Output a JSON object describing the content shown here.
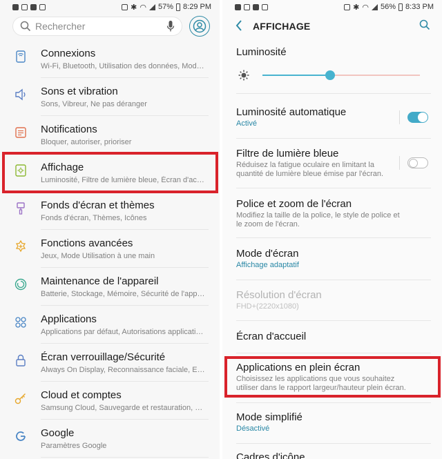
{
  "left": {
    "status": {
      "battery": "57%",
      "time": "8:29 PM"
    },
    "search": {
      "placeholder": "Rechercher"
    },
    "items": [
      {
        "title": "Connexions",
        "subtitle": "Wi-Fi, Bluetooth, Utilisation des données, Mode Hors-ligne",
        "icon": "connections-icon"
      },
      {
        "title": "Sons et vibration",
        "subtitle": "Sons, Vibreur, Ne pas déranger",
        "icon": "speaker-icon"
      },
      {
        "title": "Notifications",
        "subtitle": "Bloquer, autoriser, prioriser",
        "icon": "notifications-icon"
      },
      {
        "title": "Affichage",
        "subtitle": "Luminosité, Filtre de lumière bleue, Écran d'accueil",
        "icon": "display-icon"
      },
      {
        "title": "Fonds d'écran et thèmes",
        "subtitle": "Fonds d'écran, Thèmes, Icônes",
        "icon": "brush-icon"
      },
      {
        "title": "Fonctions avancées",
        "subtitle": "Jeux, Mode Utilisation à une main",
        "icon": "advanced-features-icon"
      },
      {
        "title": "Maintenance de l'appareil",
        "subtitle": "Batterie, Stockage, Mémoire, Sécurité de l'appareil",
        "icon": "device-care-icon"
      },
      {
        "title": "Applications",
        "subtitle": "Applications par défaut, Autorisations applications",
        "icon": "apps-icon"
      },
      {
        "title": "Écran verrouillage/Sécurité",
        "subtitle": "Always On Display, Reconnaissance faciale, Empreintes",
        "icon": "lock-icon"
      },
      {
        "title": "Cloud et comptes",
        "subtitle": "Samsung Cloud, Sauvegarde et restauration, Smart Switch",
        "icon": "key-icon"
      },
      {
        "title": "Google",
        "subtitle": "Paramètres Google",
        "icon": "google-icon"
      }
    ]
  },
  "right": {
    "status": {
      "battery": "56%",
      "time": "8:33 PM"
    },
    "header": {
      "title": "AFFICHAGE"
    },
    "brightness": {
      "label": "Luminosité",
      "level": 0.43
    },
    "auto_brightness": {
      "title": "Luminosité automatique",
      "subtitle": "Activé",
      "enabled": true
    },
    "blue_filter": {
      "title": "Filtre de lumière bleue",
      "subtitle": "Réduisez la fatigue oculaire en limitant la quantité de lumière bleue émise par l'écran.",
      "enabled": false
    },
    "font_zoom": {
      "title": "Police et zoom de l'écran",
      "subtitle": "Modifiez la taille de la police, le style de police et le zoom de l'écran."
    },
    "screen_mode": {
      "title": "Mode d'écran",
      "subtitle": "Affichage adaptatif"
    },
    "resolution": {
      "title": "Résolution d'écran",
      "subtitle": "FHD+(2220x1080)"
    },
    "home_screen": {
      "title": "Écran d'accueil"
    },
    "fullscreen_apps": {
      "title": "Applications en plein écran",
      "subtitle": "Choisissez les applications que vous souhaitez utiliser dans le rapport largeur/hauteur plein écran."
    },
    "easy_mode": {
      "title": "Mode simplifié",
      "subtitle": "Désactivé"
    },
    "icon_frames": {
      "title": "Cadres d'icône"
    }
  },
  "colors": {
    "accent": "#43aac8",
    "highlight": "#d9232b",
    "subtitle_blue": "#2887a5"
  }
}
